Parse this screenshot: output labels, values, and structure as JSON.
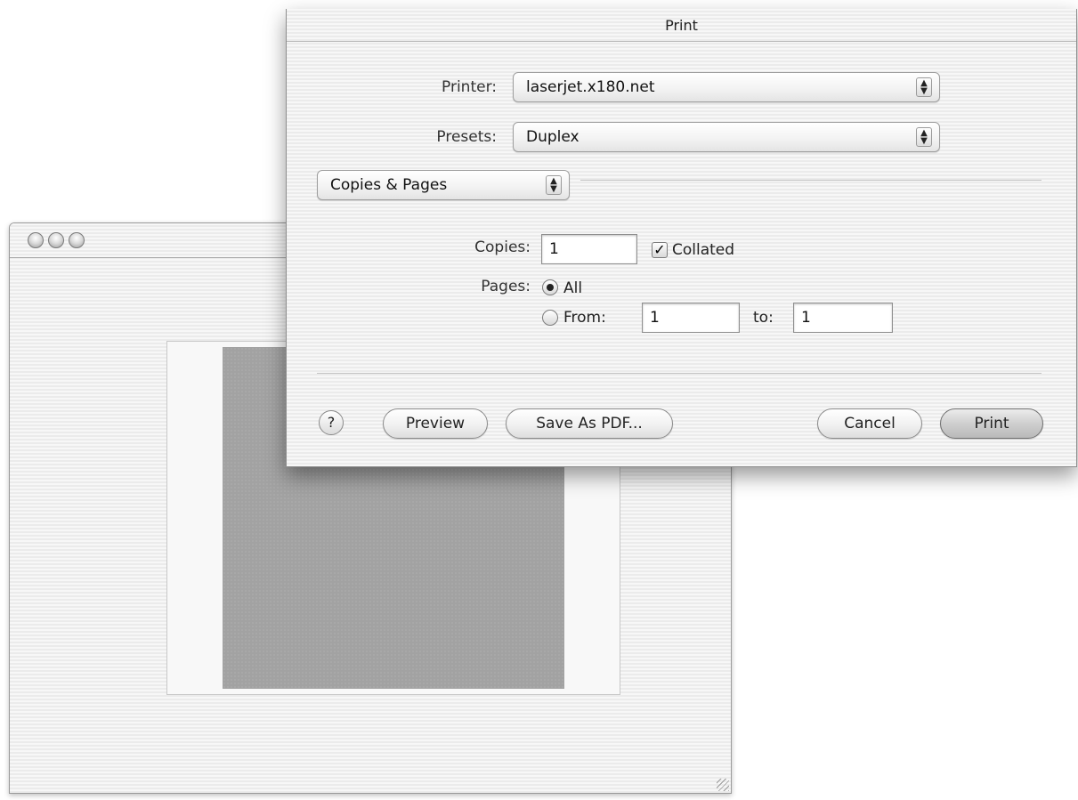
{
  "dialog": {
    "title": "Print",
    "printer": {
      "label": "Printer:",
      "value": "laserjet.x180.net"
    },
    "presets": {
      "label": "Presets:",
      "value": "Duplex"
    },
    "panel_selector": {
      "value": "Copies & Pages"
    },
    "copies": {
      "label": "Copies:",
      "value": "1",
      "collated_label": "Collated",
      "collated_checked": true
    },
    "pages": {
      "label": "Pages:",
      "all_label": "All",
      "all_selected": true,
      "from_label": "From:",
      "from_value": "1",
      "to_label": "to:",
      "to_value": "1"
    },
    "buttons": {
      "help": "?",
      "preview": "Preview",
      "save_pdf": "Save As PDF...",
      "cancel": "Cancel",
      "print": "Print"
    },
    "checkmark_glyph": "✓",
    "popup_arrows_glyph": "▲▼"
  },
  "background_window": {
    "traffic_lights": [
      "close-button",
      "minimize-button",
      "zoom-button"
    ]
  }
}
